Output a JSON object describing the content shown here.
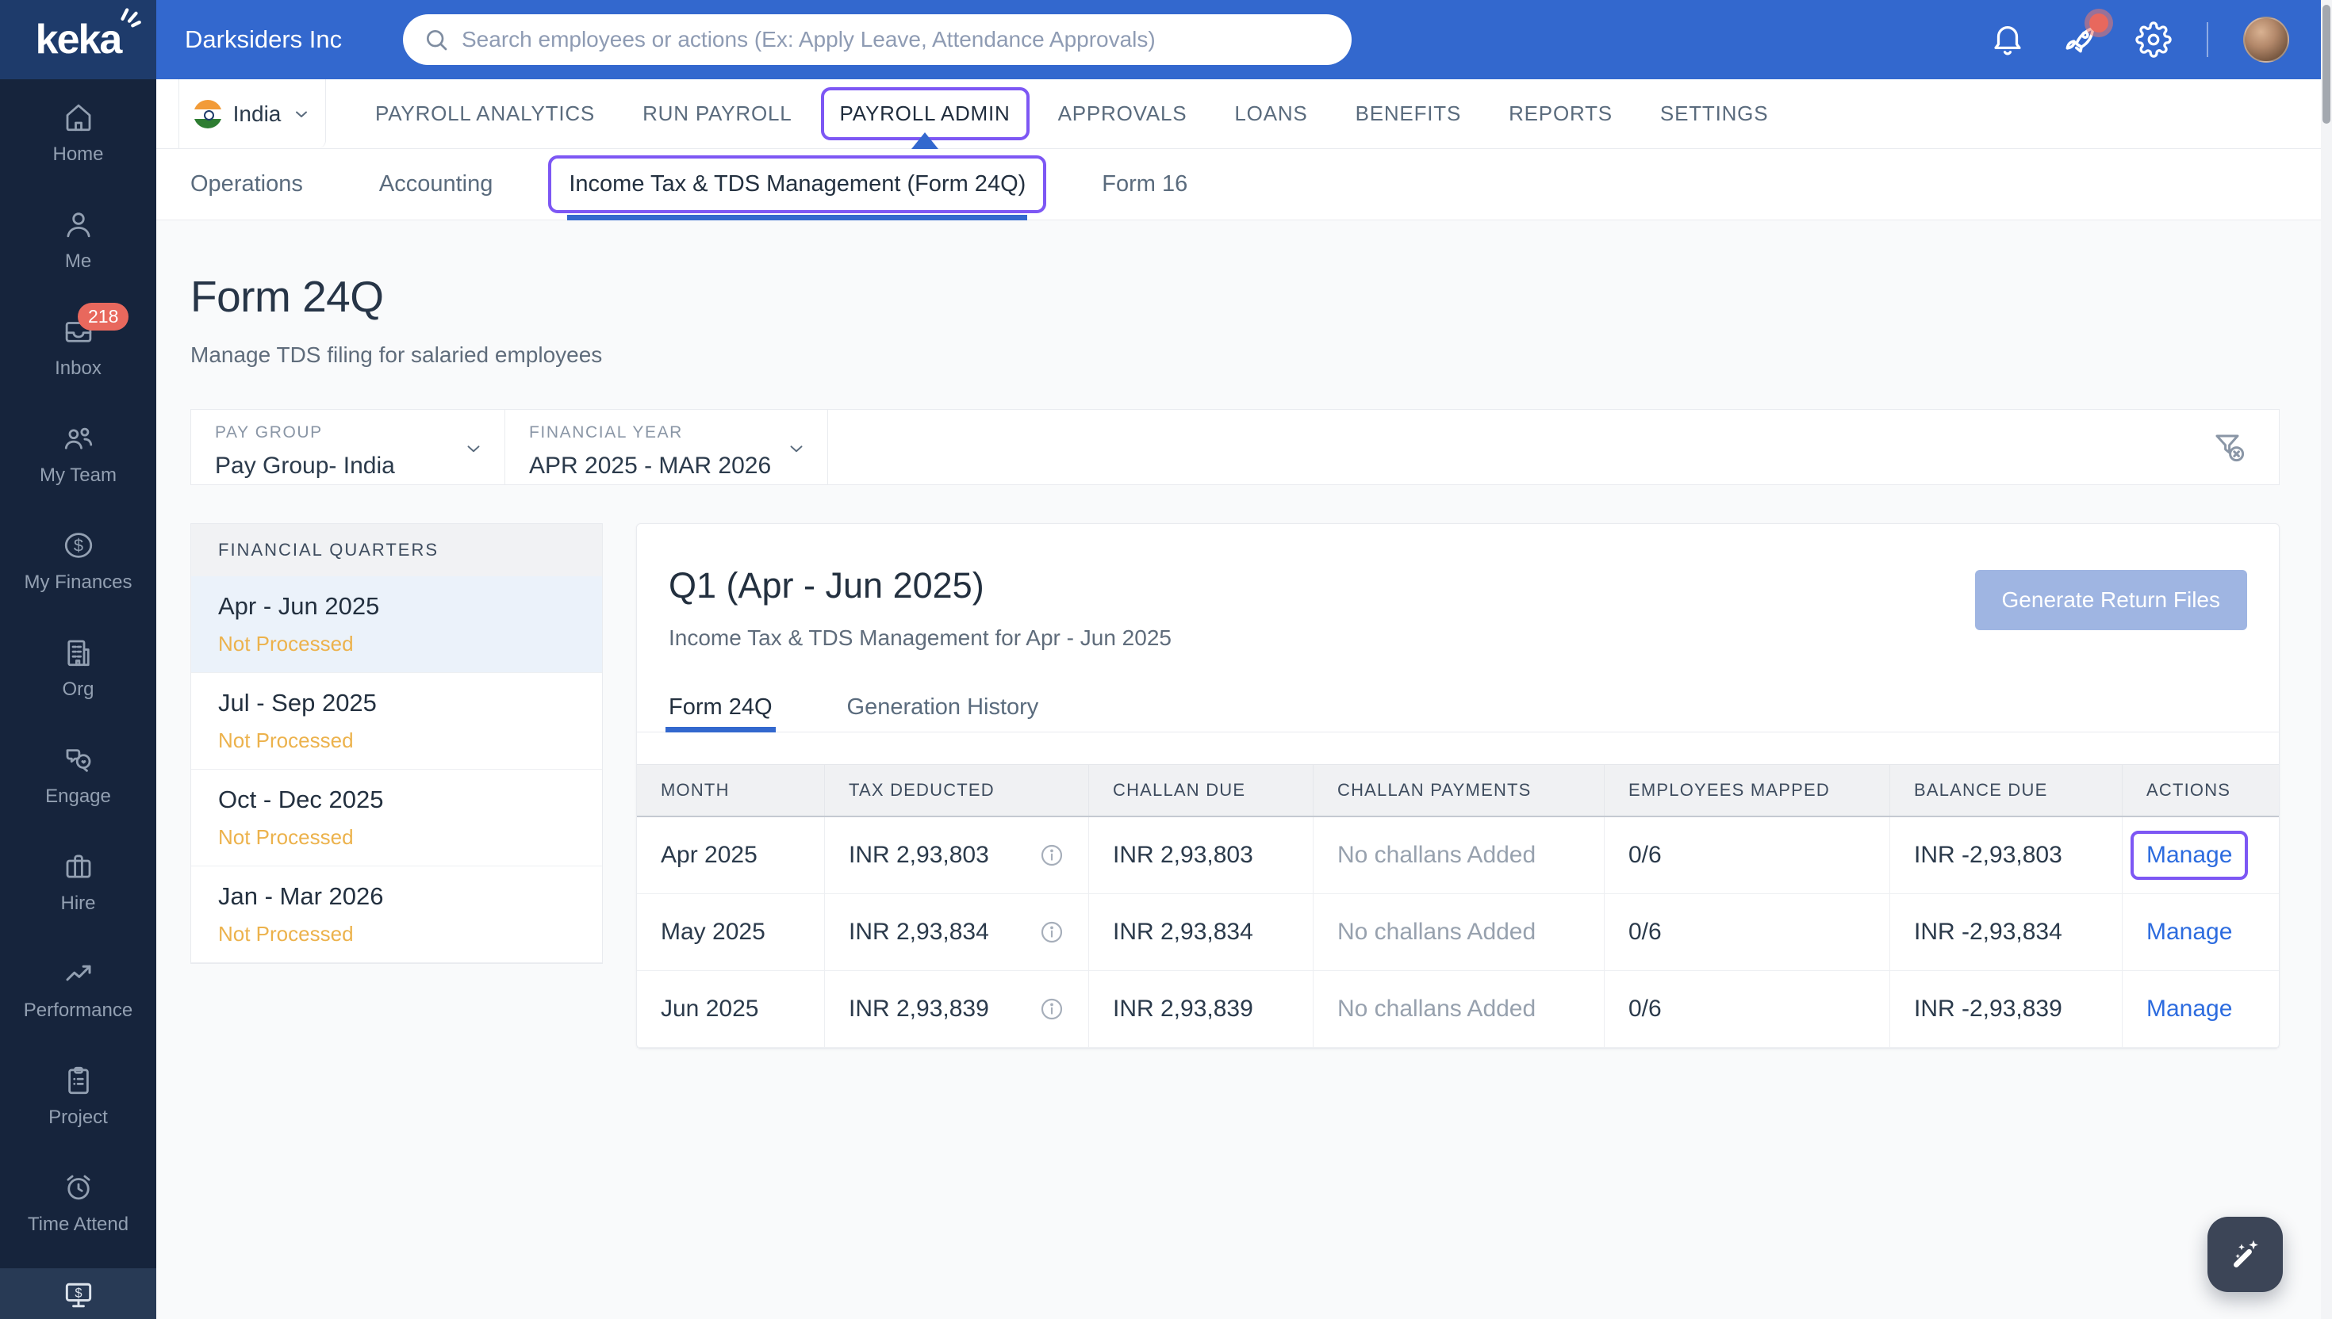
{
  "brand": {
    "logo_text": "keka"
  },
  "header": {
    "company": "Darksiders Inc",
    "search_placeholder": "Search employees or actions (Ex: Apply Leave, Attendance Approvals)",
    "icons": [
      "bell-icon",
      "rocket-icon",
      "gear-icon"
    ],
    "rocket_has_notification_dot": true
  },
  "sidebar": {
    "items": [
      {
        "label": "Home",
        "icon": "home-icon"
      },
      {
        "label": "Me",
        "icon": "person-icon"
      },
      {
        "label": "Inbox",
        "icon": "inbox-icon",
        "badge": "218"
      },
      {
        "label": "My Team",
        "icon": "team-icon"
      },
      {
        "label": "My Finances",
        "icon": "dollar-circle-icon"
      },
      {
        "label": "Org",
        "icon": "building-icon"
      },
      {
        "label": "Engage",
        "icon": "chat-icon"
      },
      {
        "label": "Hire",
        "icon": "briefcase-icon"
      },
      {
        "label": "Performance",
        "icon": "trend-icon"
      },
      {
        "label": "Project",
        "icon": "clipboard-icon"
      },
      {
        "label": "Time Attend",
        "icon": "alarm-icon"
      },
      {
        "label": "",
        "icon": "payroll-monitor-icon"
      }
    ]
  },
  "nav": {
    "country": "India",
    "items": [
      "PAYROLL ANALYTICS",
      "RUN PAYROLL",
      "PAYROLL ADMIN",
      "APPROVALS",
      "LOANS",
      "BENEFITS",
      "REPORTS",
      "SETTINGS"
    ],
    "active": "PAYROLL ADMIN"
  },
  "subnav": {
    "items": [
      "Operations",
      "Accounting",
      "Income Tax & TDS Management (Form 24Q)",
      "Form 16"
    ],
    "active": "Income Tax & TDS Management (Form 24Q)"
  },
  "page": {
    "title": "Form 24Q",
    "subtitle": "Manage TDS filing for salaried employees"
  },
  "filters": {
    "pay_group": {
      "label": "PAY GROUP",
      "value": "Pay Group- India"
    },
    "financial_year": {
      "label": "FINANCIAL YEAR",
      "value": "APR 2025 - MAR 2026"
    }
  },
  "quarters": {
    "header": "FINANCIAL QUARTERS",
    "items": [
      {
        "range": "Apr - Jun 2025",
        "status": "Not Processed",
        "selected": true
      },
      {
        "range": "Jul - Sep 2025",
        "status": "Not Processed",
        "selected": false
      },
      {
        "range": "Oct - Dec 2025",
        "status": "Not Processed",
        "selected": false
      },
      {
        "range": "Jan - Mar 2026",
        "status": "Not Processed",
        "selected": false
      }
    ]
  },
  "panel": {
    "title": "Q1 (Apr - Jun 2025)",
    "subtitle": "Income Tax & TDS Management for Apr - Jun 2025",
    "generate_button": "Generate Return Files",
    "tabs": [
      "Form 24Q",
      "Generation History"
    ],
    "active_tab": "Form 24Q"
  },
  "table": {
    "headers": [
      "MONTH",
      "TAX DEDUCTED",
      "CHALLAN DUE",
      "CHALLAN PAYMENTS",
      "EMPLOYEES MAPPED",
      "BALANCE DUE",
      "ACTIONS"
    ],
    "rows": [
      {
        "month": "Apr 2025",
        "tax_deducted": "INR 2,93,803",
        "challan_due": "INR 2,93,803",
        "challan_payments": "No challans Added",
        "employees_mapped": "0/6",
        "balance_due": "INR -2,93,803",
        "action": "Manage"
      },
      {
        "month": "May 2025",
        "tax_deducted": "INR 2,93,834",
        "challan_due": "INR 2,93,834",
        "challan_payments": "No challans Added",
        "employees_mapped": "0/6",
        "balance_due": "INR -2,93,834",
        "action": "Manage"
      },
      {
        "month": "Jun 2025",
        "tax_deducted": "INR 2,93,839",
        "challan_due": "INR 2,93,839",
        "challan_payments": "No challans Added",
        "employees_mapped": "0/6",
        "balance_due": "INR -2,93,839",
        "action": "Manage"
      }
    ]
  },
  "colors": {
    "header_blue": "#3368CE",
    "logo_navy": "#1E3B6B",
    "sidebar_navy": "#16243C",
    "annotation_purple": "#7D57F4",
    "status_amber": "#ECB24C",
    "badge_red": "#E8685D",
    "link_blue": "#2D6CDF",
    "disabled_button_blue": "#9FB5E2"
  }
}
